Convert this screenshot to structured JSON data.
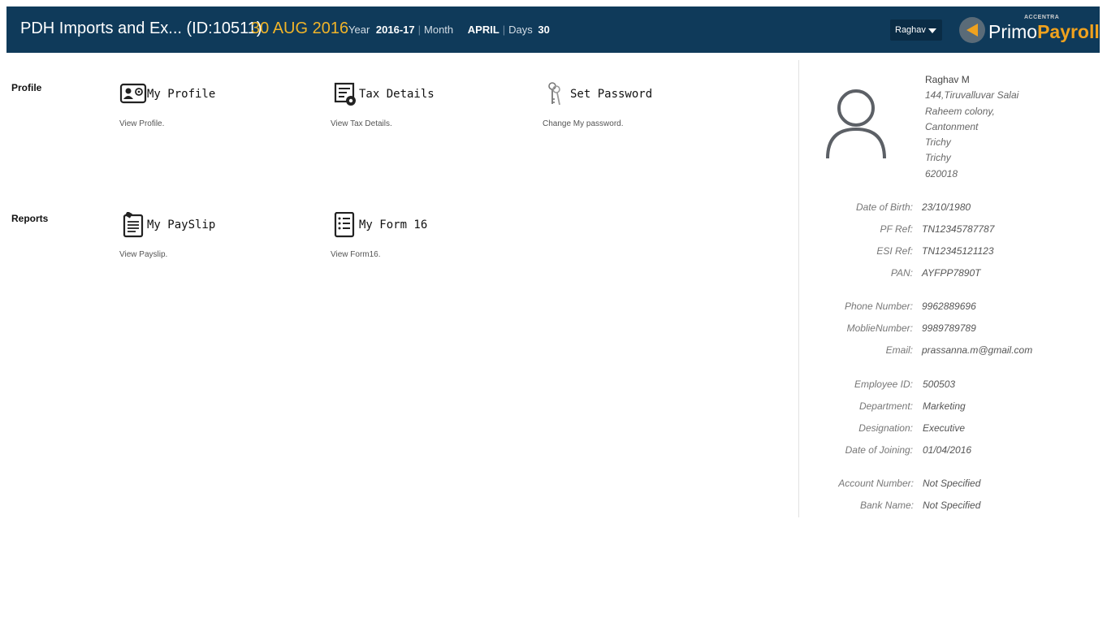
{
  "header": {
    "company": "PDH Imports and Ex... (ID:10511)",
    "date": "30 AUG 2016",
    "year_label": "Year",
    "year_value": "2016-17",
    "month_label": "Month",
    "month_value": "APRIL",
    "days_label": "Days",
    "days_value": "30",
    "user_menu": "Raghav",
    "logo_small": "ACCENTRA",
    "logo_primo": "Primo",
    "logo_payroll": "Payroll"
  },
  "sections": {
    "profile": "Profile",
    "reports": "Reports"
  },
  "tiles": {
    "my_profile": {
      "title": "My Profile",
      "desc": "View Profile."
    },
    "tax_details": {
      "title": "Tax Details",
      "desc": "View Tax Details."
    },
    "set_password": {
      "title": "Set Password",
      "desc": "Change My password."
    },
    "my_payslip": {
      "title": "My PaySlip",
      "desc": "View Payslip."
    },
    "my_form16": {
      "title": "My Form 16",
      "desc": "View Form16."
    }
  },
  "employee": {
    "name": "Raghav M",
    "address": [
      "144,Tiruvalluvar Salai",
      "Raheem colony,",
      "Cantonment",
      "Trichy",
      "Trichy",
      "620018"
    ],
    "details": [
      {
        "label": "Date of Birth:",
        "value": "23/10/1980"
      },
      {
        "label": "PF Ref:",
        "value": "TN12345787787"
      },
      {
        "label": "ESI Ref:",
        "value": "TN12345121123"
      },
      {
        "label": "PAN:",
        "value": "AYFPP7890T"
      },
      {
        "label": "Phone Number:",
        "value": "9962889696"
      },
      {
        "label": "MoblieNumber:",
        "value": "9989789789"
      },
      {
        "label": "Email:",
        "value": "prassanna.m@gmail.com"
      },
      {
        "label": "Employee ID:",
        "value": "500503"
      },
      {
        "label": "Department:",
        "value": "Marketing"
      },
      {
        "label": "Designation:",
        "value": "Executive"
      },
      {
        "label": "Date of Joining:",
        "value": "01/04/2016"
      },
      {
        "label": "Account Number:",
        "value": "Not Specified"
      },
      {
        "label": "Bank Name:",
        "value": "Not Specified"
      }
    ]
  },
  "icons": {
    "my_profile": "id-card-icon",
    "tax_details": "tax-document-icon",
    "set_password": "keys-icon",
    "my_payslip": "payslip-icon",
    "my_form16": "form-list-icon",
    "avatar": "user-avatar-icon",
    "user_menu_caret": "caret-down-icon"
  }
}
